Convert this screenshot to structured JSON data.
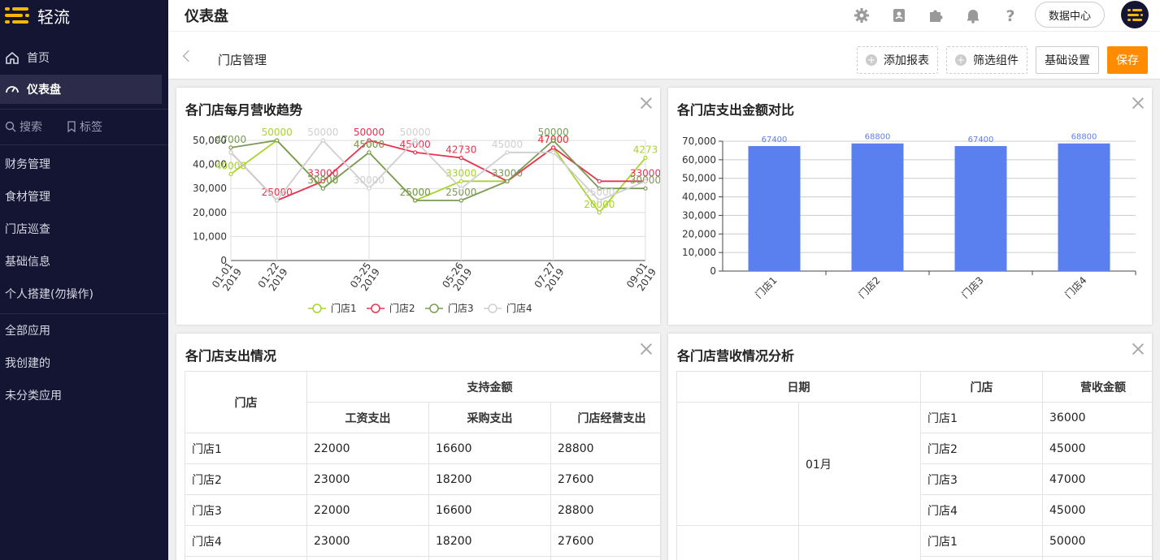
{
  "sidebar": {
    "app_name": "轻流",
    "items": [
      {
        "label": "首页",
        "icon": "home-icon",
        "active": false
      },
      {
        "label": "仪表盘",
        "icon": "dashboard-icon",
        "active": true
      }
    ],
    "search_label": "搜索",
    "tag_label": "标签",
    "groups": [
      "财务管理",
      "食材管理",
      "门店巡查",
      "基础信息",
      "个人搭建(勿操作)"
    ],
    "app_groups": [
      "全部应用",
      "我创建的",
      "未分类应用"
    ]
  },
  "topbar": {
    "title": "仪表盘",
    "icons": [
      "gear-icon",
      "contacts-icon",
      "plugin-icon",
      "bell-icon",
      "help-icon"
    ],
    "data_center_label": "数据中心"
  },
  "subbar": {
    "page_title": "门店管理",
    "add_report_label": "添加报表",
    "filter_label": "筛选组件",
    "settings_label": "基础设置",
    "save_label": "保存"
  },
  "cards": {
    "trend": {
      "title": "各门店每月营收趋势"
    },
    "expense_compare": {
      "title": "各门店支出金额对比"
    },
    "expense_table": {
      "title": "各门店支出情况",
      "header_store": "门店",
      "header_group": "支持金额",
      "columns": [
        "工资支出",
        "采购支出",
        "门店经营支出"
      ],
      "rows": [
        [
          "门店1",
          "22000",
          "16600",
          "28800"
        ],
        [
          "门店2",
          "23000",
          "18200",
          "27600"
        ],
        [
          "门店3",
          "22000",
          "16600",
          "28800"
        ],
        [
          "门店4",
          "23000",
          "18200",
          "27600"
        ]
      ]
    },
    "revenue_table": {
      "title": "各门店营收情况分析",
      "headers": [
        "日期",
        "门店",
        "营收金额"
      ],
      "month": "01月",
      "rows": [
        [
          "门店1",
          "36000"
        ],
        [
          "门店2",
          "45000"
        ],
        [
          "门店3",
          "47000"
        ],
        [
          "门店4",
          "45000"
        ],
        [
          "门店1",
          "50000"
        ]
      ]
    }
  },
  "chart_data": [
    {
      "type": "line",
      "title": "各门店每月营收趋势",
      "x_ticks": [
        "01-01\n2019",
        "01-22\n2019",
        "03-25\n2019",
        "05-26\n2019",
        "07-27\n2019",
        "09-01\n2019"
      ],
      "y_ticks": [
        "0",
        "10,000",
        "20,000",
        "30,000",
        "40,000",
        "50,000"
      ],
      "ylim": [
        0,
        50000
      ],
      "legend_position": "bottom",
      "series": [
        {
          "name": "门店1",
          "color": "#a8d42a",
          "values": [
            36000,
            50000,
            30000,
            45000,
            25000,
            33000,
            33000,
            47000,
            20000,
            42730
          ],
          "labels": [
            "40000",
            "50000",
            "30000",
            "45000",
            "25000",
            "33000",
            "",
            "47000",
            "20000",
            "4273"
          ]
        },
        {
          "name": "门店2",
          "color": "#e8334f",
          "values": [
            45000,
            25000,
            33000,
            50000,
            45000,
            42730,
            33000,
            47000,
            33000,
            33000
          ],
          "labels": [
            "",
            "25000",
            "33000",
            "50000",
            "45000",
            "42730",
            "",
            "47000",
            "",
            "33000"
          ]
        },
        {
          "name": "门店3",
          "color": "#7a9a55",
          "values": [
            47000,
            50000,
            30000,
            45000,
            25000,
            25000,
            33000,
            50000,
            30000,
            30000
          ],
          "labels": [
            "47000",
            "",
            "30000",
            "45000",
            "25000",
            "25000",
            "33000",
            "50000",
            "",
            "30000"
          ]
        },
        {
          "name": "门店4",
          "color": "#cfcfcf",
          "values": [
            45000,
            25000,
            50000,
            30000,
            50000,
            30000,
            45000,
            45000,
            25000,
            33000
          ],
          "labels": [
            "",
            "",
            "50000",
            "30000",
            "50000",
            "",
            "45000",
            "",
            "25000",
            ""
          ]
        }
      ],
      "x_positions": [
        0,
        1,
        2,
        3,
        4,
        5,
        6,
        7,
        8,
        9
      ]
    },
    {
      "type": "bar",
      "title": "各门店支出金额对比",
      "categories": [
        "门店1",
        "门店2",
        "门店3",
        "门店4"
      ],
      "values": [
        67400,
        68800,
        67400,
        68800
      ],
      "y_ticks": [
        "0",
        "10,000",
        "20,000",
        "30,000",
        "40,000",
        "50,000",
        "60,000",
        "70,000"
      ],
      "ylim": [
        0,
        70000
      ],
      "color": "#5a7fef"
    }
  ]
}
